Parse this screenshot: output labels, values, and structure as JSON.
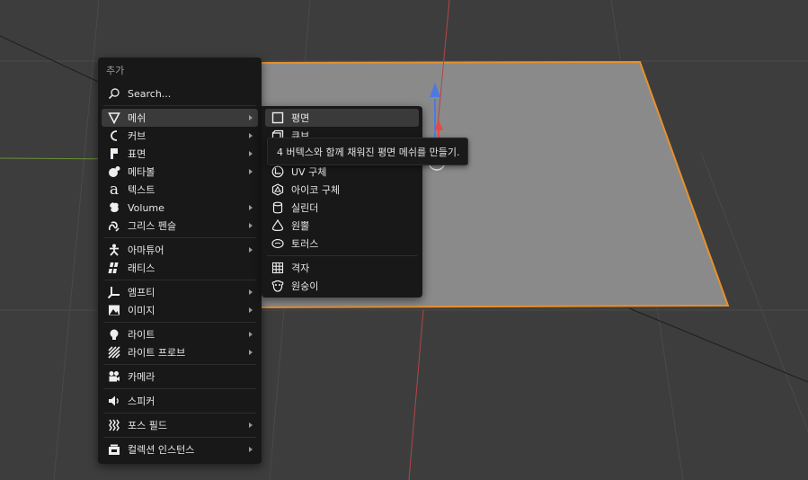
{
  "add_menu": {
    "title": "추가",
    "search_label": "Search...",
    "items": [
      {
        "label": "메쉬",
        "icon": "mesh-icon",
        "submenu": true
      },
      {
        "label": "커브",
        "icon": "curve-icon",
        "submenu": true
      },
      {
        "label": "표면",
        "icon": "surface-icon",
        "submenu": true
      },
      {
        "label": "메타볼",
        "icon": "metaball-icon",
        "submenu": true
      },
      {
        "label": "텍스트",
        "icon": "text-icon",
        "submenu": false
      },
      {
        "label": "Volume",
        "icon": "volume-icon",
        "submenu": true
      },
      {
        "label": "그리스 펜슬",
        "icon": "grease-pencil-icon",
        "submenu": true
      },
      {
        "label": "아마튜어",
        "icon": "armature-icon",
        "submenu": true
      },
      {
        "label": "래티스",
        "icon": "lattice-icon",
        "submenu": false
      },
      {
        "label": "엠프티",
        "icon": "empty-icon",
        "submenu": true
      },
      {
        "label": "이미지",
        "icon": "image-icon",
        "submenu": true
      },
      {
        "label": "라이트",
        "icon": "light-icon",
        "submenu": true
      },
      {
        "label": "라이트 프로브",
        "icon": "light-probe-icon",
        "submenu": true
      },
      {
        "label": "카메라",
        "icon": "camera-icon",
        "submenu": false
      },
      {
        "label": "스피커",
        "icon": "speaker-icon",
        "submenu": false
      },
      {
        "label": "포스 필드",
        "icon": "force-field-icon",
        "submenu": true
      },
      {
        "label": "컬렉션 인스턴스",
        "icon": "collection-instance-icon",
        "submenu": true
      }
    ]
  },
  "mesh_menu": {
    "items": [
      {
        "label": "평면",
        "icon": "plane-icon"
      },
      {
        "label": "큐브",
        "icon": "cube-icon"
      },
      {
        "label": "UV 구체",
        "icon": "uv-sphere-icon"
      },
      {
        "label": "아이코 구체",
        "icon": "ico-sphere-icon"
      },
      {
        "label": "실린더",
        "icon": "cylinder-icon"
      },
      {
        "label": "원뿔",
        "icon": "cone-icon"
      },
      {
        "label": "토러스",
        "icon": "torus-icon"
      },
      {
        "label": "격자",
        "icon": "grid-icon"
      },
      {
        "label": "원숭이",
        "icon": "monkey-icon"
      }
    ]
  },
  "tooltip": {
    "text": "4 버텍스와 함께 채워진 평면 메쉬를 만들기."
  },
  "colors": {
    "menu_bg": "#181818",
    "active_row": "#3a3a3a",
    "selection_outline": "#e8902c",
    "plane_fill": "#8a8a8a",
    "x_axis": "#c94a4a",
    "gizmo_z": "#4d79e0",
    "gizmo_x": "#e24a4a"
  }
}
